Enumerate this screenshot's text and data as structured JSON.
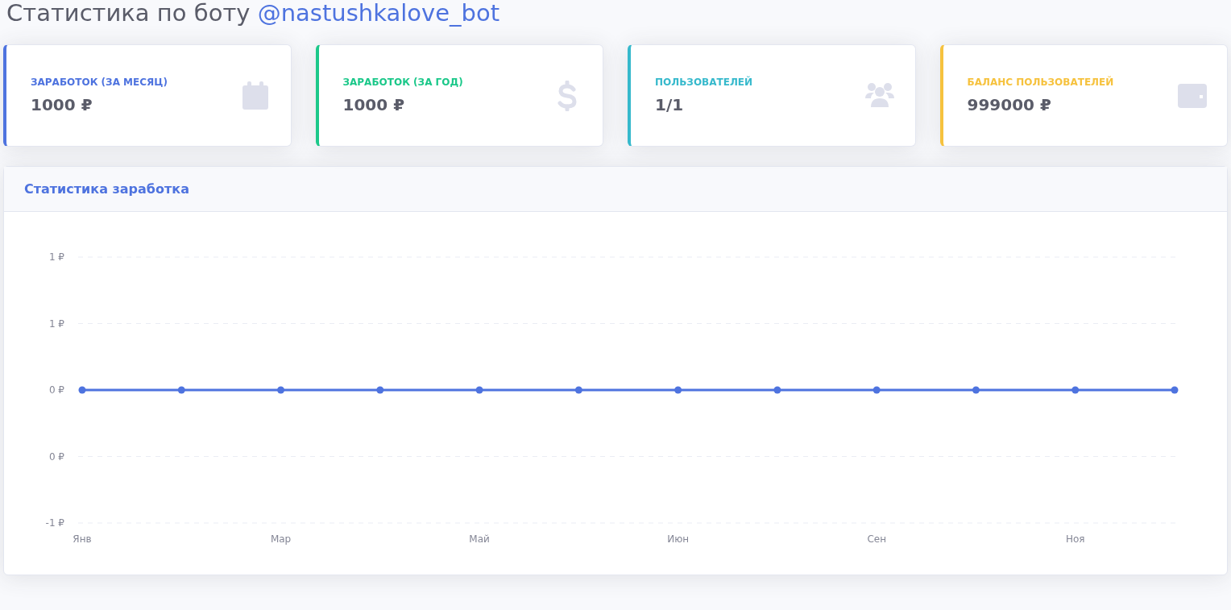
{
  "page_title": {
    "text": "Статистика по боту ",
    "bot_link": "@nastushkalove_bot"
  },
  "stat_cards": [
    {
      "label": "ЗАРАБОТОК (ЗА МЕСЯЦ)",
      "value": "1000 ₽",
      "color": "#4e73df",
      "kind": "calendar"
    },
    {
      "label": "ЗАРАБОТОК (ЗА ГОД)",
      "value": "1000 ₽",
      "color": "#1cc88a",
      "kind": "dollar"
    },
    {
      "label": "ПОЛЬЗОВАТЕЛЕЙ",
      "value": "1/1",
      "color": "#36b9cc",
      "kind": "users"
    },
    {
      "label": "БАЛАНС ПОЛЬЗОВАТЕЛЕЙ",
      "value": "999000 ₽",
      "color": "#f6c23e",
      "kind": "wallet"
    }
  ],
  "chart_card": {
    "title": "Статистика заработка",
    "chart_data": {
      "type": "line",
      "categories": [
        "Янв",
        null,
        "Мар",
        null,
        "Май",
        null,
        "Июн",
        null,
        "Сен",
        null,
        "Ноя",
        null
      ],
      "series": [
        {
          "color": "#4e73df",
          "marker": true,
          "values": [
            0,
            0,
            0,
            0,
            0,
            0,
            0,
            0,
            0,
            0,
            0,
            0
          ]
        }
      ],
      "grid": true,
      "ylim": [
        -1,
        1
      ],
      "yticks": [
        {
          "value": 1,
          "label": "1 ₽"
        },
        {
          "value": 0.5,
          "label": "1 ₽"
        },
        {
          "value": 0,
          "label": "0 ₽"
        },
        {
          "value": -0.5,
          "label": "0 ₽"
        },
        {
          "value": -1,
          "label": "-1 ₽"
        }
      ]
    }
  }
}
